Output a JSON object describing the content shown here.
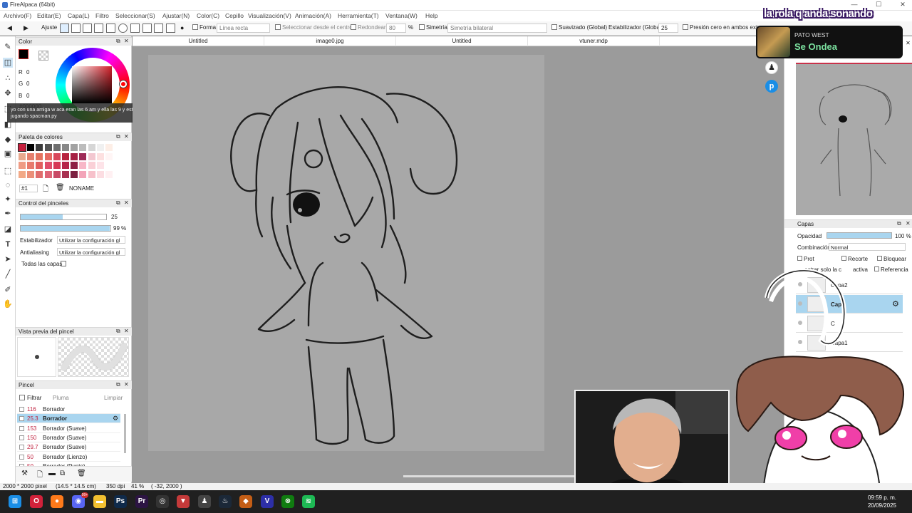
{
  "window": {
    "title": "FireAlpaca (64bit)",
    "minimize": "—",
    "maximize": "☐",
    "close": "✕"
  },
  "menu": [
    "Archivo(F)",
    "Editar(E)",
    "Capa(L)",
    "Filtro",
    "Seleccionar(S)",
    "Ajustar(N)",
    "Color(C)",
    "Cepillo",
    "Visualización(V)",
    "Animación(A)",
    "Herramienta(T)",
    "Ventana(W)",
    "Help"
  ],
  "toolbar": {
    "adjust_label": "Ajuste",
    "forma_label": "Forma",
    "forma_value": "Línea recta",
    "select_center": "Seleccionar desde el centro",
    "rounded_label": "Redondear",
    "rounded_value": "80",
    "percent": "%",
    "symmetry_label": "Simetría",
    "symmetry_value": "Simetría bilateral",
    "smooth_label": "Suavizado (Global)",
    "stabilizer_label": "Estabilizador (Global)",
    "stabilizer_value": "25",
    "pressure_label": "Presión cero en ambos extre"
  },
  "color_panel": {
    "title": "Color",
    "r_label": "R",
    "r_value": "0",
    "g_label": "G",
    "g_value": "0",
    "b_label": "B",
    "b_value": "0",
    "hex": "#000000",
    "current_color": "#000000"
  },
  "tooltip": {
    "text": "yo con una amiga w aca eran las 6 am y ella las 9 y estabamos jugando spacman.py"
  },
  "palette_panel": {
    "title": "Paleta de colores",
    "index": "#1",
    "name": "NONAME",
    "colors": [
      "#c6203d",
      "#000000",
      "#3b3b3b",
      "#555555",
      "#6e6e6e",
      "#888888",
      "#a2a2a2",
      "#bcbcbc",
      "#d6d6d6",
      "#f0f0f0",
      "#fdeee6",
      "#e9a98e",
      "#e57f6d",
      "#e4735f",
      "#e56a62",
      "#d9475a",
      "#b8233f",
      "#a61f43",
      "#9e2a57",
      "#f3c7d0",
      "#fde0e0",
      "#fff5f5",
      "#ef9b84",
      "#e77a6d",
      "#e15f5f",
      "#e04e6b",
      "#d63755",
      "#b62549",
      "#8e1f44",
      "#f8b7c7",
      "#fad0d7",
      "#fde3e8",
      "#ffffff",
      "#f2a987",
      "#eb8f79",
      "#e06d6d",
      "#df6577",
      "#c84a66",
      "#a83050",
      "#7d2141",
      "#f3a4b9",
      "#f7c1cb",
      "#fcdde2",
      "#fff0f2"
    ]
  },
  "brush_control": {
    "title": "Control del pinceles",
    "size": "25",
    "size_fraction": 0.49,
    "opacity": "99 %",
    "opacity_fraction": 0.99,
    "stabilizer_label": "Estabilizador",
    "stabilizer_value": "Utilizar la configuración gl",
    "antialias_label": "Antialiasing",
    "antialias_value": "Utilizar la configuración gl",
    "all_layers": "Todas las capas"
  },
  "brush_preview": {
    "title": "Vista previa del pincel"
  },
  "brush_panel": {
    "title": "Pincel",
    "filter": "Filtrar",
    "category": "Pluma",
    "clear": "Limpiar",
    "items": [
      {
        "size": "116",
        "name": "Borrador"
      },
      {
        "size": "25.3",
        "name": "Borrador",
        "selected": true
      },
      {
        "size": "153",
        "name": "Borrador (Suave)"
      },
      {
        "size": "150",
        "name": "Borrador (Suave)"
      },
      {
        "size": "29.7",
        "name": "Borrador (Suave)"
      },
      {
        "size": "50",
        "name": "Borrador (Lienzo)"
      },
      {
        "size": "50",
        "name": "Borrador (Punto)"
      }
    ]
  },
  "tabs": [
    "Untitled",
    "image0.jpg",
    "Untitled",
    "vtuner.mdp"
  ],
  "layers_panel": {
    "title": "Capas",
    "opacity_label": "Opacidad",
    "opacity_value": "100 %",
    "opacity_fraction": 1.0,
    "blend_label": "Combinación",
    "blend_value": "Normal",
    "protect": "Prot",
    "clip": "Recorte",
    "lock": "Bloquear",
    "show_only": "ostrar solo la c",
    "active": "activa",
    "reference": "Referencia",
    "layers": [
      {
        "name": "Capa2",
        "selected": false
      },
      {
        "name": "Capa",
        "selected": true
      },
      {
        "name": "C",
        "selected": false
      },
      {
        "name": "Capa1",
        "selected": false
      }
    ]
  },
  "status": {
    "size": "2000 * 2000 pixel",
    "cm": "(14.5 * 14.5 cm)",
    "dpi": "350 dpi",
    "zoom": "41 %",
    "coords": "( -32, 2000 )"
  },
  "overlay": {
    "stream_title": "la rola q anda sonando",
    "artist": "PATO WEST",
    "song": "Se Ondea"
  },
  "taskbar": {
    "time": "09:59 p. m.",
    "date": "20/09/2025",
    "badge": "99+",
    "apps": [
      {
        "name": "windows-start",
        "glyph": "⊞",
        "color": "#1a8ee6"
      },
      {
        "name": "opera",
        "glyph": "O",
        "color": "#d2213a"
      },
      {
        "name": "firefox",
        "glyph": "●",
        "color": "#ff7a1a"
      },
      {
        "name": "discord",
        "glyph": "◉",
        "color": "#5865f2"
      },
      {
        "name": "file-explorer",
        "glyph": "▬",
        "color": "#f3c030"
      },
      {
        "name": "photoshop",
        "glyph": "Ps",
        "color": "#0f2a4a"
      },
      {
        "name": "premiere",
        "glyph": "Pr",
        "color": "#2c1443"
      },
      {
        "name": "obs",
        "glyph": "◎",
        "color": "#333333"
      },
      {
        "name": "vtube",
        "glyph": "▼",
        "color": "#c43a3a"
      },
      {
        "name": "penguin-app",
        "glyph": "♟",
        "color": "#444444"
      },
      {
        "name": "steam",
        "glyph": "♨",
        "color": "#1b2838"
      },
      {
        "name": "firealpaca",
        "glyph": "◆",
        "color": "#c45e16"
      },
      {
        "name": "vscode-v",
        "glyph": "V",
        "color": "#2d2fa8"
      },
      {
        "name": "xbox",
        "glyph": "⊗",
        "color": "#107c10"
      },
      {
        "name": "spotify",
        "glyph": "≋",
        "color": "#1db954"
      }
    ]
  }
}
